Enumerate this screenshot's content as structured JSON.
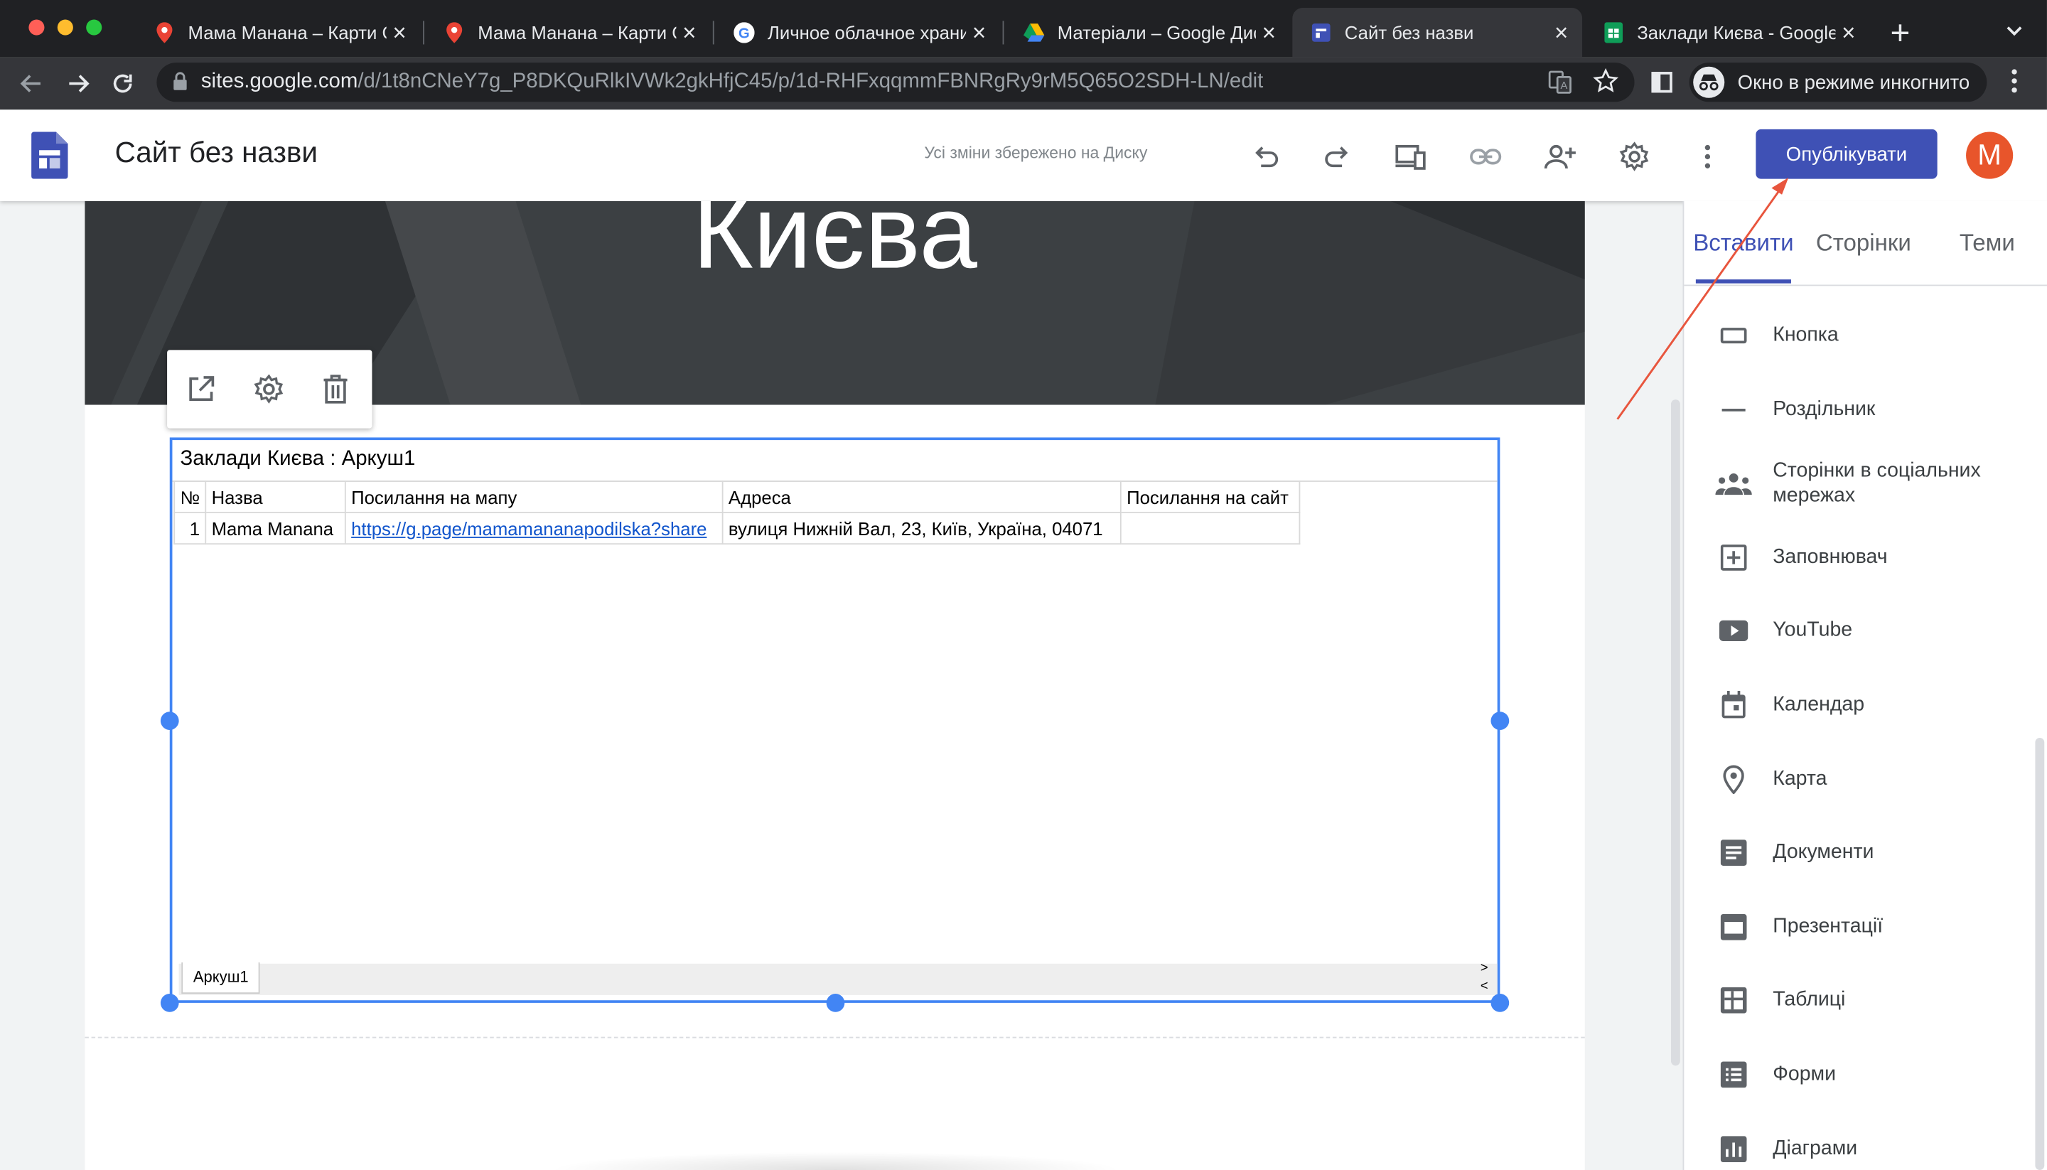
{
  "browser": {
    "tabs": [
      {
        "title": "Мама Манана – Карти G",
        "icon": "maps-pin-icon"
      },
      {
        "title": "Мама Манана – Карти G",
        "icon": "maps-pin-icon"
      },
      {
        "title": "Личное облачное храни",
        "icon": "google-g-icon"
      },
      {
        "title": "Матеріали – Google Дис",
        "icon": "drive-icon"
      },
      {
        "title": "Сайт без назви",
        "icon": "sites-icon"
      },
      {
        "title": "Заклади Києва - Google",
        "icon": "sheets-icon"
      }
    ],
    "url_host": "sites.google.com",
    "url_path": "/d/1t8nCNeY7g_P8DKQuRlkIVWk2gkHfjC45/p/1d-RHFxqqmmFBNRgRy9rM5Q65O2SDH-LN/edit",
    "incognito_label": "Окно в режиме инкогнито"
  },
  "header": {
    "doc_title": "Сайт без назви",
    "saved_status": "Усі зміни збережено на Диску",
    "publish_label": "Опублікувати",
    "avatar_letter": "M"
  },
  "hero": {
    "title": "Києва"
  },
  "embed": {
    "sheet_title": "Заклади Києва : Аркуш1",
    "columns": [
      "№",
      "Назва",
      "Посилання на мапу",
      "Адреса",
      "Посилання на сайт"
    ],
    "rows": [
      {
        "num": "1",
        "name": "Mama Manana",
        "map_link": "https://g.page/mamamananapodilska?share",
        "address": "вулиця Нижній Вал, 23, Київ, Україна, 04071",
        "site": ""
      }
    ],
    "sheet_tab": "Аркуш1",
    "nav_next": ">",
    "nav_prev": "<"
  },
  "panel": {
    "tabs": [
      "Вставити",
      "Сторінки",
      "Теми"
    ],
    "items": [
      {
        "label": "Кнопка",
        "icon": "button-icon"
      },
      {
        "label": "Роздільник",
        "icon": "divider-icon"
      },
      {
        "label": "Сторінки в соціальних мережах",
        "icon": "people-icon"
      },
      {
        "label": "Заповнювач",
        "icon": "placeholder-icon"
      },
      {
        "label": "YouTube",
        "icon": "youtube-icon"
      },
      {
        "label": "Календар",
        "icon": "calendar-icon"
      },
      {
        "label": "Карта",
        "icon": "map-pin-icon"
      },
      {
        "label": "Документи",
        "icon": "docs-icon"
      },
      {
        "label": "Презентації",
        "icon": "slides-icon"
      },
      {
        "label": "Таблиці",
        "icon": "sheets-icon"
      },
      {
        "label": "Форми",
        "icon": "forms-icon"
      },
      {
        "label": "Діаграми",
        "icon": "charts-icon"
      }
    ]
  },
  "colors": {
    "accent": "#3f51b5",
    "selection": "#4285f4",
    "annotation": "#e8553d"
  }
}
